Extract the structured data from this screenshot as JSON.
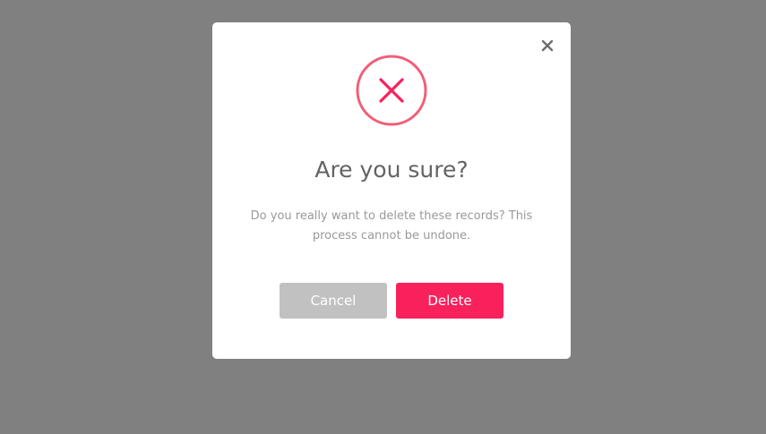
{
  "overlay": {
    "background": "#808080"
  },
  "modal": {
    "close_icon": "close-icon",
    "status_icon": "error-circle-x-icon",
    "accent_color": "#f8215c",
    "title": "Are you sure?",
    "message_line1": "Do you really want to delete these records? This",
    "message_line2": "process cannot be undone.",
    "cancel_label": "Cancel",
    "delete_label": "Delete",
    "cancel_color": "#c1c1c1",
    "delete_color": "#f8215c"
  }
}
